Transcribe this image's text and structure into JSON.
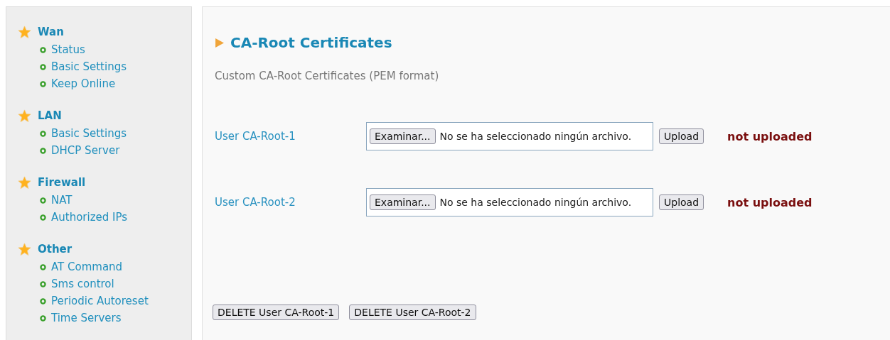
{
  "sidebar": {
    "groups": [
      {
        "title": "Wan",
        "items": [
          "Status",
          "Basic Settings",
          "Keep Online"
        ]
      },
      {
        "title": "LAN",
        "items": [
          "Basic Settings",
          "DHCP Server"
        ]
      },
      {
        "title": "Firewall",
        "items": [
          "NAT",
          "Authorized IPs"
        ]
      },
      {
        "title": "Other",
        "items": [
          "AT Command",
          "Sms control",
          "Periodic Autoreset",
          "Time Servers"
        ]
      }
    ]
  },
  "main": {
    "heading": "CA-Root Certificates",
    "description": "Custom CA-Root Certificates (PEM format)",
    "certificates": [
      {
        "label": "User CA-Root-1",
        "browse_button": "Examinar...",
        "file_value": "No se ha seleccionado ningún archivo.",
        "upload_button": "Upload",
        "status": "not uploaded"
      },
      {
        "label": "User CA-Root-2",
        "browse_button": "Examinar...",
        "file_value": "No se ha seleccionado ningún archivo.",
        "upload_button": "Upload",
        "status": "not uploaded"
      }
    ],
    "delete_buttons": [
      "DELETE User CA-Root-1",
      "DELETE User CA-Root-2"
    ]
  }
}
